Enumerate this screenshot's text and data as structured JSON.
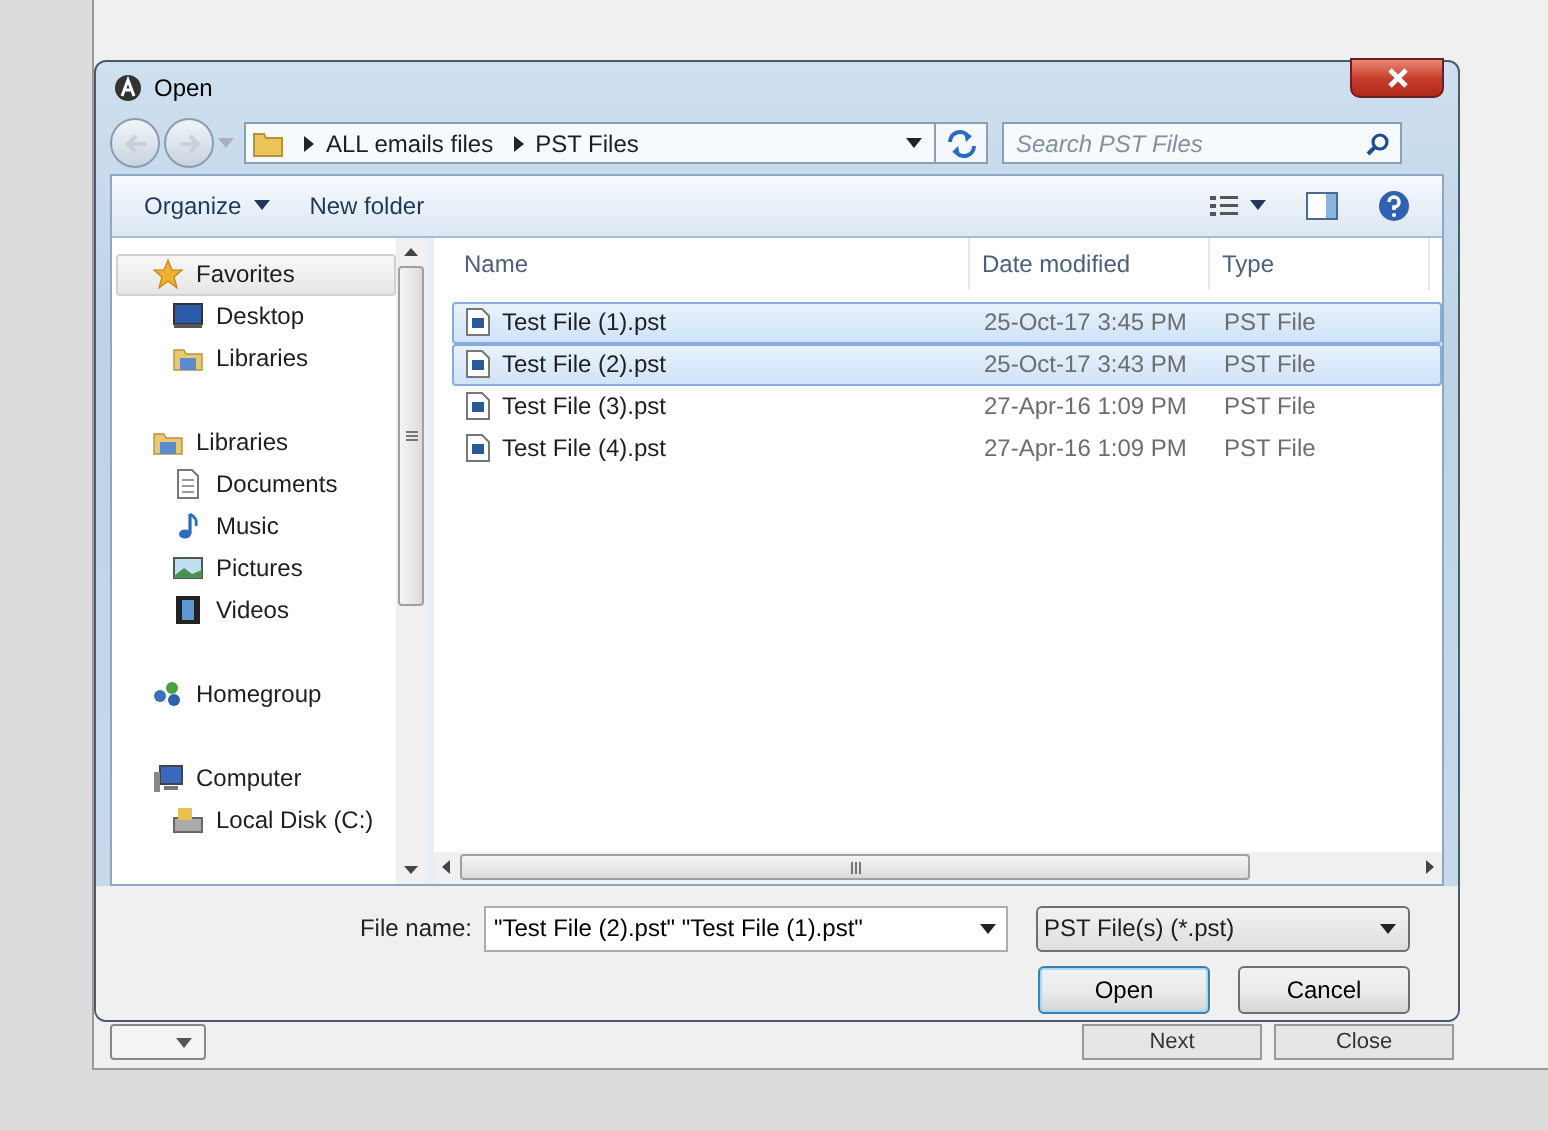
{
  "window": {
    "title": "Open"
  },
  "address_bar": {
    "path": [
      "ALL emails files",
      "PST Files"
    ]
  },
  "search": {
    "placeholder": "Search PST Files"
  },
  "toolbar": {
    "organize": "Organize",
    "new_folder": "New folder"
  },
  "sidebar": {
    "groups": [
      {
        "label": "Favorites",
        "kind": "star",
        "selected": true,
        "children": [
          {
            "label": "Desktop",
            "kind": "desktop",
            "selected": false
          },
          {
            "label": "Libraries",
            "kind": "library",
            "selected": false
          }
        ]
      },
      {
        "label": "Libraries",
        "kind": "library",
        "selected": false,
        "children": [
          {
            "label": "Documents",
            "kind": "document",
            "selected": false
          },
          {
            "label": "Music",
            "kind": "music",
            "selected": false
          },
          {
            "label": "Pictures",
            "kind": "picture",
            "selected": false
          },
          {
            "label": "Videos",
            "kind": "video",
            "selected": false
          }
        ]
      },
      {
        "label": "Homegroup",
        "kind": "homegroup",
        "selected": false
      },
      {
        "label": "Computer",
        "kind": "computer",
        "selected": false,
        "children": [
          {
            "label": "Local Disk (C:)",
            "kind": "disk",
            "selected": false
          }
        ]
      }
    ]
  },
  "table": {
    "columns": [
      "Name",
      "Date modified",
      "Type"
    ],
    "rows": [
      {
        "name": "Test File (1).pst",
        "date": "25-Oct-17 3:45 PM",
        "type": "PST File",
        "selected": true
      },
      {
        "name": "Test File (2).pst",
        "date": "25-Oct-17 3:43 PM",
        "type": "PST File",
        "selected": true
      },
      {
        "name": "Test File (3).pst",
        "date": "27-Apr-16 1:09 PM",
        "type": "PST File",
        "selected": false
      },
      {
        "name": "Test File (4).pst",
        "date": "27-Apr-16 1:09 PM",
        "type": "PST File",
        "selected": false
      }
    ]
  },
  "file_name": {
    "label": "File name:",
    "value": "\"Test File (2).pst\" \"Test File (1).pst\""
  },
  "file_type": "PST File(s) (*.pst)",
  "buttons": [
    {
      "label": "Open",
      "kind": "default"
    },
    {
      "label": "Cancel",
      "kind": "normal"
    }
  ],
  "background_buttons": [
    "Next",
    "Close"
  ]
}
